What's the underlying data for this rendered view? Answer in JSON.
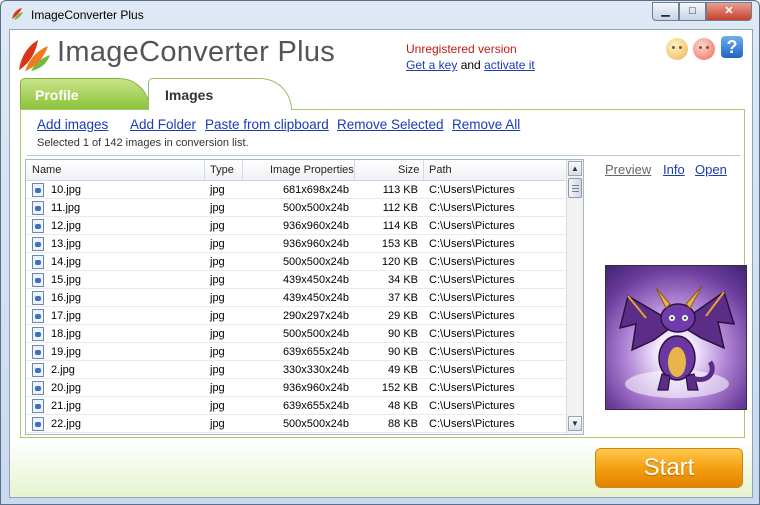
{
  "window": {
    "title": "ImageConverter Plus",
    "minimize_glyph": "▁",
    "maximize_glyph": "□",
    "close_glyph": "✕"
  },
  "header": {
    "app_title": "ImageConverter Plus",
    "unregistered": "Unregistered version",
    "get_key": "Get a key",
    "and_text": "and",
    "activate": "activate it",
    "help_glyph": "?"
  },
  "tabs": [
    {
      "label": "Profile",
      "active": false
    },
    {
      "label": "Images",
      "active": true
    }
  ],
  "actions": {
    "add_images": "Add images",
    "add_folder": "Add Folder",
    "paste": "Paste from clipboard",
    "remove_selected": "Remove Selected",
    "remove_all": "Remove All"
  },
  "status": "Selected 1 of 142 images in conversion list.",
  "columns": {
    "name": "Name",
    "type": "Type",
    "props": "Image Properties",
    "size": "Size",
    "path": "Path"
  },
  "rows": [
    {
      "name": "10.jpg",
      "type": "jpg",
      "props": "681x698x24b",
      "size": "113 KB",
      "path": "C:\\Users\\Pictures"
    },
    {
      "name": "11.jpg",
      "type": "jpg",
      "props": "500x500x24b",
      "size": "112 KB",
      "path": "C:\\Users\\Pictures"
    },
    {
      "name": "12.jpg",
      "type": "jpg",
      "props": "936x960x24b",
      "size": "114 KB",
      "path": "C:\\Users\\Pictures"
    },
    {
      "name": "13.jpg",
      "type": "jpg",
      "props": "936x960x24b",
      "size": "153 KB",
      "path": "C:\\Users\\Pictures"
    },
    {
      "name": "14.jpg",
      "type": "jpg",
      "props": "500x500x24b",
      "size": "120 KB",
      "path": "C:\\Users\\Pictures"
    },
    {
      "name": "15.jpg",
      "type": "jpg",
      "props": "439x450x24b",
      "size": "34 KB",
      "path": "C:\\Users\\Pictures"
    },
    {
      "name": "16.jpg",
      "type": "jpg",
      "props": "439x450x24b",
      "size": "37 KB",
      "path": "C:\\Users\\Pictures"
    },
    {
      "name": "17.jpg",
      "type": "jpg",
      "props": "290x297x24b",
      "size": "29 KB",
      "path": "C:\\Users\\Pictures"
    },
    {
      "name": "18.jpg",
      "type": "jpg",
      "props": "500x500x24b",
      "size": "90 KB",
      "path": "C:\\Users\\Pictures"
    },
    {
      "name": "19.jpg",
      "type": "jpg",
      "props": "639x655x24b",
      "size": "90 KB",
      "path": "C:\\Users\\Pictures"
    },
    {
      "name": "2.jpg",
      "type": "jpg",
      "props": "330x330x24b",
      "size": "49 KB",
      "path": "C:\\Users\\Pictures"
    },
    {
      "name": "20.jpg",
      "type": "jpg",
      "props": "936x960x24b",
      "size": "152 KB",
      "path": "C:\\Users\\Pictures"
    },
    {
      "name": "21.jpg",
      "type": "jpg",
      "props": "639x655x24b",
      "size": "48 KB",
      "path": "C:\\Users\\Pictures"
    },
    {
      "name": "22.jpg",
      "type": "jpg",
      "props": "500x500x24b",
      "size": "88 KB",
      "path": "C:\\Users\\Pictures"
    }
  ],
  "side": {
    "preview": "Preview",
    "info": "Info",
    "open": "Open"
  },
  "start_label": "Start",
  "colors": {
    "link": "#1a3cb4",
    "unregistered": "#c41818",
    "tab_green": "#8cc33a",
    "start_orange": "#f39b0c"
  }
}
